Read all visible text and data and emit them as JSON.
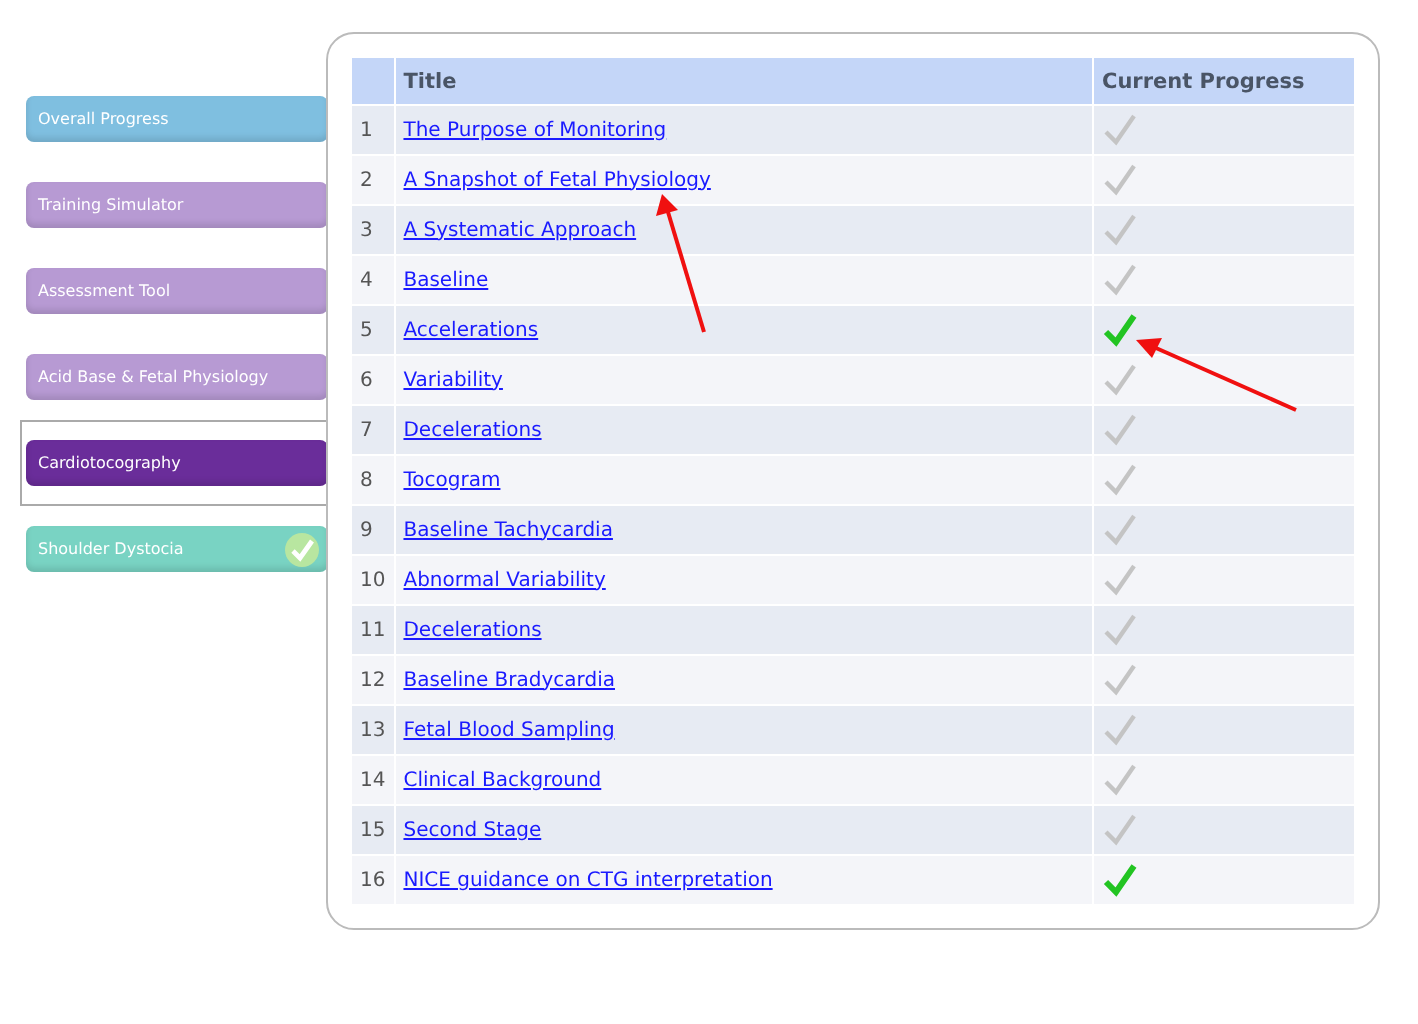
{
  "sidebar": {
    "items": [
      {
        "label": "Overall Progress",
        "color": "#7fbfe0",
        "selected": false,
        "completed": false
      },
      {
        "label": "Training Simulator",
        "color": "#b79ad3",
        "selected": false,
        "completed": false
      },
      {
        "label": "Assessment Tool",
        "color": "#b79ad3",
        "selected": false,
        "completed": false
      },
      {
        "label": "Acid Base & Fetal Physiology",
        "color": "#b79ad3",
        "selected": false,
        "completed": false
      },
      {
        "label": "Cardiotocography",
        "color": "#6a2d9a",
        "selected": true,
        "completed": false
      },
      {
        "label": "Shoulder Dystocia",
        "color": "#79d3c3",
        "selected": false,
        "completed": true
      }
    ]
  },
  "table": {
    "columns": [
      "Title",
      "Current Progress"
    ],
    "rows": [
      {
        "number": "1",
        "title": "The Purpose of Monitoring",
        "completed": false
      },
      {
        "number": "2",
        "title": "A Snapshot of Fetal Physiology",
        "completed": false
      },
      {
        "number": "3",
        "title": "A Systematic Approach",
        "completed": false
      },
      {
        "number": "4",
        "title": "Baseline",
        "completed": false
      },
      {
        "number": "5",
        "title": "Accelerations",
        "completed": true
      },
      {
        "number": "6",
        "title": "Variability",
        "completed": false
      },
      {
        "number": "7",
        "title": "Decelerations",
        "completed": false
      },
      {
        "number": "8",
        "title": "Tocogram",
        "completed": false
      },
      {
        "number": "9",
        "title": "Baseline Tachycardia",
        "completed": false
      },
      {
        "number": "10",
        "title": "Abnormal Variability",
        "completed": false
      },
      {
        "number": "11",
        "title": "Decelerations",
        "completed": false
      },
      {
        "number": "12",
        "title": "Baseline Bradycardia",
        "completed": false
      },
      {
        "number": "13",
        "title": "Fetal Blood Sampling",
        "completed": false
      },
      {
        "number": "14",
        "title": "Clinical Background",
        "completed": false
      },
      {
        "number": "15",
        "title": "Second Stage",
        "completed": false
      },
      {
        "number": "16",
        "title": "NICE guidance on CTG interpretation",
        "completed": true
      }
    ]
  }
}
